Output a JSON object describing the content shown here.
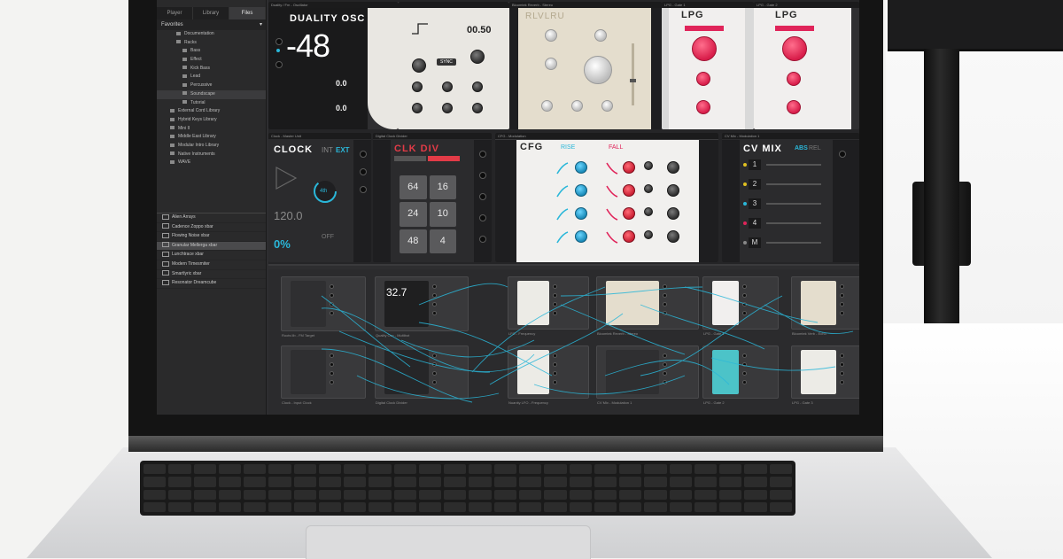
{
  "browser": {
    "tabs": [
      "Player",
      "Library",
      "Files"
    ],
    "active_tab": 2,
    "section": "Favorites",
    "tree": [
      {
        "label": "Documentation",
        "indent": 2,
        "selected": false
      },
      {
        "label": "Racks",
        "indent": 2,
        "selected": false
      },
      {
        "label": "Bass",
        "indent": 3,
        "selected": false
      },
      {
        "label": "Effect",
        "indent": 3,
        "selected": false
      },
      {
        "label": "Kick Bass",
        "indent": 3,
        "selected": false
      },
      {
        "label": "Lead",
        "indent": 3,
        "selected": false
      },
      {
        "label": "Percussive",
        "indent": 3,
        "selected": false
      },
      {
        "label": "Soundscape",
        "indent": 3,
        "selected": true
      },
      {
        "label": "Tutorial",
        "indent": 3,
        "selected": false
      },
      {
        "label": "External Cord Library",
        "indent": 1,
        "selected": false
      },
      {
        "label": "Hybrid Keys Library",
        "indent": 1,
        "selected": false
      },
      {
        "label": "Mini II",
        "indent": 1,
        "selected": false
      },
      {
        "label": "Middle East Library",
        "indent": 1,
        "selected": false
      },
      {
        "label": "Modular Intro Library",
        "indent": 1,
        "selected": false
      },
      {
        "label": "Native Instruments",
        "indent": 1,
        "selected": false
      },
      {
        "label": "WAVE",
        "indent": 1,
        "selected": false
      }
    ],
    "presets": [
      {
        "label": "Alien Arrays",
        "selected": false
      },
      {
        "label": "Cadence Zoppo xbar",
        "selected": false
      },
      {
        "label": "Flowing Noise xbar",
        "selected": false
      },
      {
        "label": "Granular Mellerga xbar",
        "selected": true
      },
      {
        "label": "Lunchtrace xbar",
        "selected": false
      },
      {
        "label": "Modern Timesmiter",
        "selected": false
      },
      {
        "label": "Smartlyric xbar",
        "selected": false
      },
      {
        "label": "Resonator Dreamcube",
        "selected": false
      }
    ]
  },
  "modules_top": [
    {
      "header": "Duality / Fm - Oscillator",
      "title": "DUALITY OSC",
      "display": "-48",
      "readout_a": "0.0",
      "readout_b": "0.0",
      "sub": "00.50",
      "sync": "SYNC"
    },
    {
      "header": "Bloomtek Reverb - Stereo",
      "title": "RLVLRU"
    },
    {
      "header": "LPG - Gate 1",
      "title": "LPG"
    },
    {
      "header": "LPG - Gate 2",
      "title": "LPG"
    }
  ],
  "modules_mid": [
    {
      "header": "Clock - Master Unit",
      "title": "CLOCK",
      "int": "INT",
      "ext": "EXT",
      "bpm": "120.0",
      "swing": "0%",
      "rate": "4th",
      "off": "OFF"
    },
    {
      "header": "Digital Clock Divider",
      "title": "CLK DIV",
      "pads": [
        "64",
        "16",
        "24",
        "10",
        "48",
        "4"
      ]
    },
    {
      "header": "CFG - Modulation",
      "title": "CFG",
      "rise": "RISE",
      "fall": "FALL"
    },
    {
      "header": "CV Mix - Modulation 1",
      "title": "CV MIX",
      "abs": "ABS",
      "rel": "REL",
      "channels": [
        "1",
        "2",
        "3",
        "4",
        "M"
      ]
    }
  ],
  "patch": {
    "modules": [
      {
        "label": "Roots lib - FM Target"
      },
      {
        "label": "Quality Osc - Multibot",
        "display": "32.7"
      },
      {
        "label": "LFO - Frequency"
      },
      {
        "label": "Bloomtek Reverb - Stereo"
      },
      {
        "label": "LPG - Gate 1"
      },
      {
        "label": "Bloomtek Verb - Echo"
      },
      {
        "label": "Clock - Input Clock"
      },
      {
        "label": "Digital Clock Divider"
      },
      {
        "label": "Nuanity LFO - Frequency"
      },
      {
        "label": "CV Mix - Modulation 1"
      },
      {
        "label": "LPG - Gate 2"
      },
      {
        "label": "LPG - Gate 3"
      }
    ]
  },
  "colors": {
    "accent": "#2ab7d9",
    "pink": "#e0245a",
    "red": "#e23b47"
  }
}
